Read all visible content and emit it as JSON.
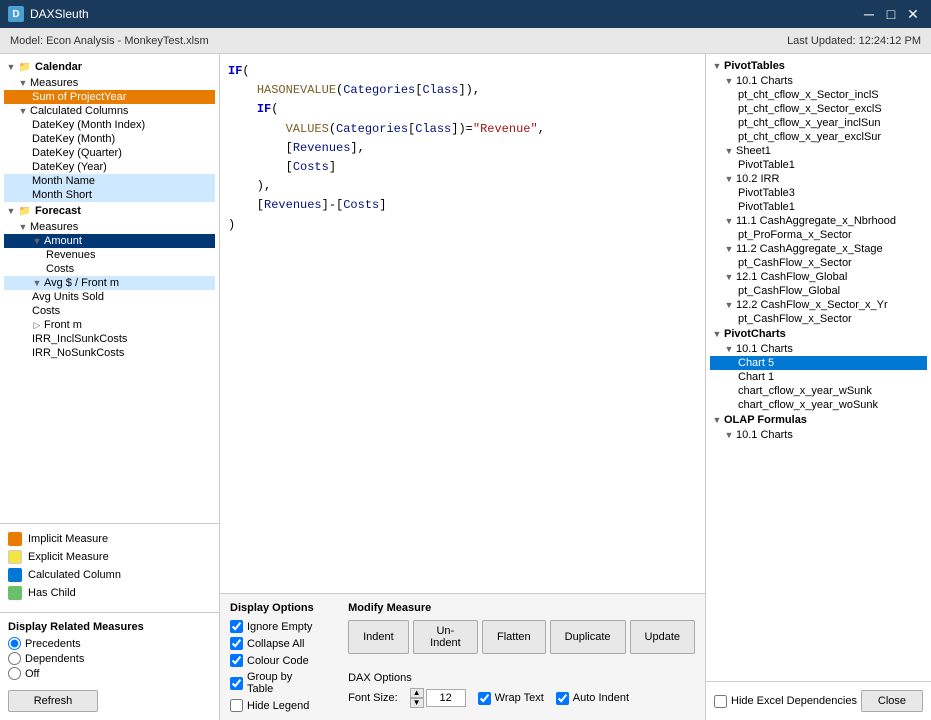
{
  "titleBar": {
    "title": "DAXSleuth",
    "icon": "D",
    "closeBtn": "✕",
    "minBtn": "─",
    "maxBtn": "□"
  },
  "modelBar": {
    "modelLabel": "Model: Econ Analysis - MonkeyTest.xlsm",
    "lastUpdated": "Last Updated: 12:24:12 PM"
  },
  "leftTree": {
    "sections": [
      {
        "name": "Calendar",
        "items": [
          {
            "label": "Measures",
            "indent": 1,
            "type": "folder"
          },
          {
            "label": "Sum of ProjectYear",
            "indent": 2,
            "type": "measure",
            "selected": true,
            "color": "orange"
          },
          {
            "label": "Calculated Columns",
            "indent": 1,
            "type": "folder"
          },
          {
            "label": "DateKey (Month Index)",
            "indent": 2,
            "type": "leaf"
          },
          {
            "label": "DateKey (Month)",
            "indent": 2,
            "type": "leaf"
          },
          {
            "label": "DateKey (Quarter)",
            "indent": 2,
            "type": "leaf"
          },
          {
            "label": "DateKey (Year)",
            "indent": 2,
            "type": "leaf"
          },
          {
            "label": "Month Name",
            "indent": 2,
            "type": "leaf",
            "highlight": true
          },
          {
            "label": "Month Short",
            "indent": 2,
            "type": "leaf",
            "highlight": true
          }
        ]
      },
      {
        "name": "Forecast",
        "items": [
          {
            "label": "Measures",
            "indent": 1,
            "type": "folder"
          },
          {
            "label": "Amount",
            "indent": 2,
            "type": "measure",
            "selected": true,
            "color": "blue-dark"
          },
          {
            "label": "Revenues",
            "indent": 3,
            "type": "leaf"
          },
          {
            "label": "Costs",
            "indent": 3,
            "type": "leaf"
          },
          {
            "label": "Avg $ / Front m",
            "indent": 2,
            "type": "measure",
            "highlight": true
          },
          {
            "label": "Avg Units Sold",
            "indent": 2,
            "type": "leaf"
          },
          {
            "label": "Costs",
            "indent": 2,
            "type": "leaf"
          },
          {
            "label": "Front m",
            "indent": 2,
            "type": "folder"
          },
          {
            "label": "IRR_InclSunkCosts",
            "indent": 2,
            "type": "leaf"
          },
          {
            "label": "IRR_NoSunkCosts",
            "indent": 2,
            "type": "leaf"
          }
        ]
      }
    ]
  },
  "legend": {
    "title": "",
    "items": [
      {
        "label": "Implicit Measure",
        "color": "#e87c00"
      },
      {
        "label": "Explicit Measure",
        "color": "#f5e642"
      },
      {
        "label": "Calculated Column",
        "color": "#0078d4"
      },
      {
        "label": "Has Child",
        "color": "#6abf6a"
      }
    ]
  },
  "displayRelatedMeasures": {
    "title": "Display Related Measures",
    "options": [
      {
        "label": "Precedents",
        "value": "precedents",
        "selected": true
      },
      {
        "label": "Dependents",
        "value": "dependents",
        "selected": false
      },
      {
        "label": "Off",
        "value": "off",
        "selected": false
      }
    ],
    "refreshBtn": "Refresh"
  },
  "codeEditor": {
    "code": "IF(\n    HASONEVALUE(Categories[Class]),\n    IF(\n        VALUES(Categories[Class])=\"Revenue\",\n        [Revenues],\n        [Costs]\n    ),\n    [Revenues]-[Costs]\n)"
  },
  "displayOptions": {
    "title": "Display Options",
    "checkboxes": [
      {
        "label": "Ignore Empty",
        "checked": true
      },
      {
        "label": "Collapse All",
        "checked": true
      },
      {
        "label": "Colour Code",
        "checked": true
      },
      {
        "label": "Group by Table",
        "checked": true
      },
      {
        "label": "Hide Legend",
        "checked": false
      }
    ]
  },
  "modifyMeasure": {
    "title": "Modify Measure",
    "buttons": [
      "Indent",
      "Un-Indent",
      "Flatten",
      "Duplicate",
      "Update"
    ]
  },
  "daxOptions": {
    "title": "DAX Options",
    "fontSizeLabel": "Font Size:",
    "fontSize": "12",
    "wrapText": {
      "label": "Wrap Text",
      "checked": true
    },
    "autoIndent": {
      "label": "Auto Indent",
      "checked": true
    }
  },
  "rightPanel": {
    "title": "PivotTables",
    "sections": [
      {
        "name": "PivotTables",
        "items": [
          {
            "label": "10.1 Charts",
            "indent": 1
          },
          {
            "label": "pt_cht_cflow_x_Sector_inclS",
            "indent": 2
          },
          {
            "label": "pt_cht_cflow_x_Sector_exclS",
            "indent": 2
          },
          {
            "label": "pt_cht_cflow_x_year_inclSun",
            "indent": 2
          },
          {
            "label": "pt_cht_cflow_x_year_exclSur",
            "indent": 2
          },
          {
            "label": "Sheet1",
            "indent": 1
          },
          {
            "label": "PivotTable1",
            "indent": 2
          },
          {
            "label": "10.2 IRR",
            "indent": 1
          },
          {
            "label": "PivotTable3",
            "indent": 2
          },
          {
            "label": "PivotTable1",
            "indent": 2
          },
          {
            "label": "11.1 CashAggregate_x_Nbrhood",
            "indent": 1
          },
          {
            "label": "pt_ProForma_x_Sector",
            "indent": 2
          },
          {
            "label": "11.2 CashAggregate_x_Stage",
            "indent": 1
          },
          {
            "label": "pt_CashFlow_x_Sector",
            "indent": 2
          },
          {
            "label": "12.1 CashFlow_Global",
            "indent": 1
          },
          {
            "label": "pt_CashFlow_Global",
            "indent": 2
          },
          {
            "label": "12.2 CashFlow_x_Sector_x_Yr",
            "indent": 1
          },
          {
            "label": "pt_CashFlow_x_Sector",
            "indent": 2
          }
        ]
      },
      {
        "name": "PivotCharts",
        "items": [
          {
            "label": "10.1 Charts",
            "indent": 1
          },
          {
            "label": "Chart 5",
            "indent": 2,
            "selected": true
          },
          {
            "label": "Chart 1",
            "indent": 2
          },
          {
            "label": "chart_cflow_x_year_wSunk",
            "indent": 2
          },
          {
            "label": "chart_cflow_x_year_woSunk",
            "indent": 2
          }
        ]
      },
      {
        "name": "OLAP Formulas",
        "items": [
          {
            "label": "10.1 Charts",
            "indent": 1
          }
        ]
      }
    ]
  },
  "rightBottom": {
    "hideExcelDeps": "Hide Excel Dependencies",
    "closeBtn": "Close"
  }
}
